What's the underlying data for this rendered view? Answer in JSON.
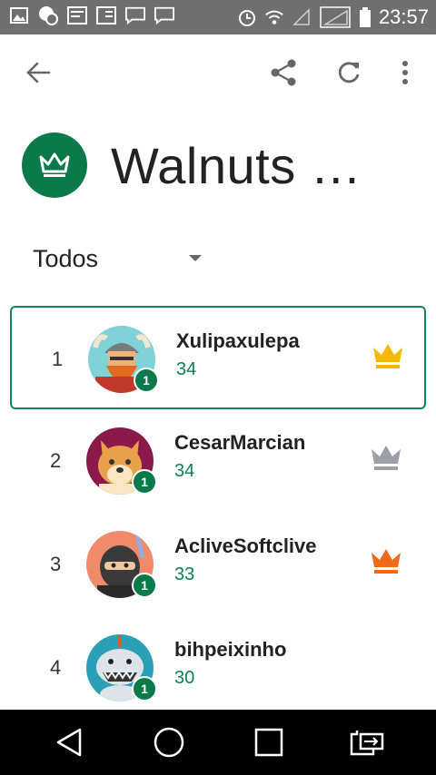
{
  "status_bar": {
    "time": "23:57",
    "left_icons": [
      "image-icon",
      "notification-icon",
      "notification-icon",
      "notification-icon",
      "chat-icon",
      "chat-icon"
    ],
    "right_icons": [
      "alarm-icon",
      "wifi-icon",
      "signal-icon",
      "signal-icon",
      "battery-icon"
    ]
  },
  "app_bar": {
    "back_icon": "arrow-back-icon",
    "actions": [
      "share-icon",
      "refresh-icon",
      "more-vert-icon"
    ]
  },
  "header": {
    "title": "Walnuts C...",
    "badge_icon": "crown-icon"
  },
  "filter": {
    "selected": "Todos"
  },
  "leaderboard": {
    "rows": [
      {
        "rank": "1",
        "name": "Xulipaxulepa",
        "score": "34",
        "level": "1",
        "crown_color": "#f5b800",
        "avatar": "viking-avatar",
        "selected": true
      },
      {
        "rank": "2",
        "name": "CesarMarcian",
        "score": "34",
        "level": "1",
        "crown_color": "#9aa0a6",
        "avatar": "dog-avatar",
        "selected": false
      },
      {
        "rank": "3",
        "name": "AcliveSoftclive",
        "score": "33",
        "level": "1",
        "crown_color": "#f06a1a",
        "avatar": "ninja-avatar",
        "selected": false
      },
      {
        "rank": "4",
        "name": "bihpeixinho",
        "score": "30",
        "level": "1",
        "crown_color": "",
        "avatar": "shark-avatar",
        "selected": false
      }
    ]
  },
  "nav_bar": {
    "buttons": [
      "back-triangle-icon",
      "home-circle-icon",
      "recents-square-icon",
      "switch-icon"
    ]
  },
  "colors": {
    "accent": "#0a7a4a",
    "score": "#0e7d57",
    "status_bar": "#6f6f6f"
  }
}
